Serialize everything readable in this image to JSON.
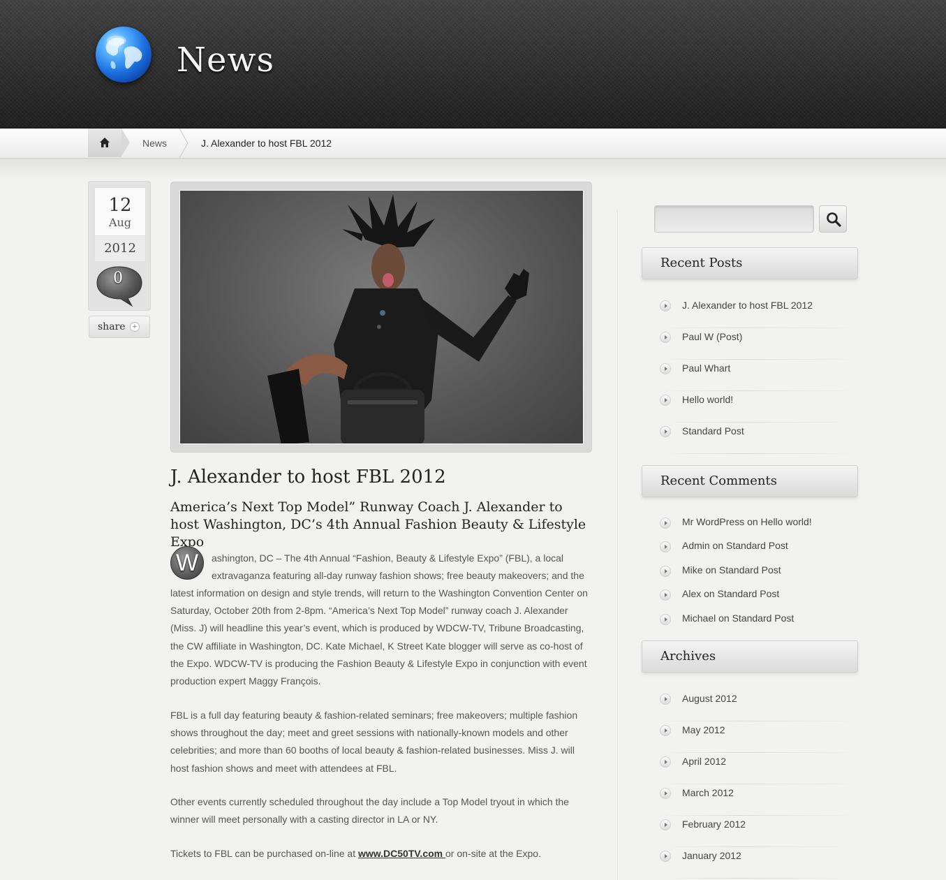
{
  "header": {
    "site_title": "News",
    "logo_icon": "globe-icon"
  },
  "breadcrumb": {
    "home_icon": "home-icon",
    "items": [
      "News",
      "J. Alexander to host FBL 2012"
    ]
  },
  "post_meta": {
    "day": "12",
    "month": "Aug",
    "year": "2012",
    "comment_count": "0",
    "share_label": "share",
    "share_icon": "+"
  },
  "post": {
    "title": "J. Alexander to host FBL 2012",
    "subtitle": "America’s Next Top Model” Runway Coach J. Alexander to host Washington, DC’s 4th Annual Fashion Beauty & Lifestyle Expo",
    "dropcap": "W",
    "p1_line1": "ashington, DC – The 4th Annual “Fashion, Beauty & Lifestyle Expo” (FBL), a local",
    "p1_line2": "extravaganza featuring all-day runway fashion shows; free beauty makeovers; and the",
    "p1_rest": "latest information on design and style trends, will return to the Washington Convention Center on Saturday, October 20th from 2-8pm. “America’s Next Top Model” runway coach J. Alexander (Miss. J) will headline this year’s event, which is produced by WDCW-TV, Tribune Broadcasting, the CW affiliate in Washington, DC. Kate Michael, K Street Kate blogger will serve as co-host of the Expo. WDCW-TV is producing the Fashion Beauty & Lifestyle Expo in conjunction with event production expert Maggy François.",
    "p2": "FBL is a full day featuring beauty & fashion-related seminars; free makeovers; multiple fashion shows throughout the day; meet and greet sessions with nationally-known models and other celebrities; and more than 60 booths of local beauty & fashion-related businesses. Miss J. will host fashion shows and meet with attendees at FBL.",
    "p3": "Other events currently scheduled throughout the day include a Top Model tryout in which the winner will meet personally with a casting director in LA or NY.",
    "p4_before": "Tickets to FBL can be purchased on-line at ",
    "p4_link": "www.DC50TV.com ",
    "p4_after": "or on-site at the Expo."
  },
  "sidebar": {
    "search": {
      "placeholder": "",
      "icon": "search-icon"
    },
    "recent_posts": {
      "title": "Recent Posts",
      "items": [
        "J. Alexander to host FBL 2012",
        "Paul W (Post)",
        "Paul Whart",
        "Hello world!",
        "Standard Post"
      ]
    },
    "recent_comments": {
      "title": "Recent Comments",
      "items": [
        "Mr WordPress on Hello world!",
        "Admin on Standard Post",
        "Mike on Standard Post",
        "Alex on Standard Post",
        "Michael on Standard Post"
      ]
    },
    "archives": {
      "title": "Archives",
      "items": [
        "August 2012",
        "May 2012",
        "April 2012",
        "March 2012",
        "February 2012",
        "January 2012"
      ]
    }
  }
}
